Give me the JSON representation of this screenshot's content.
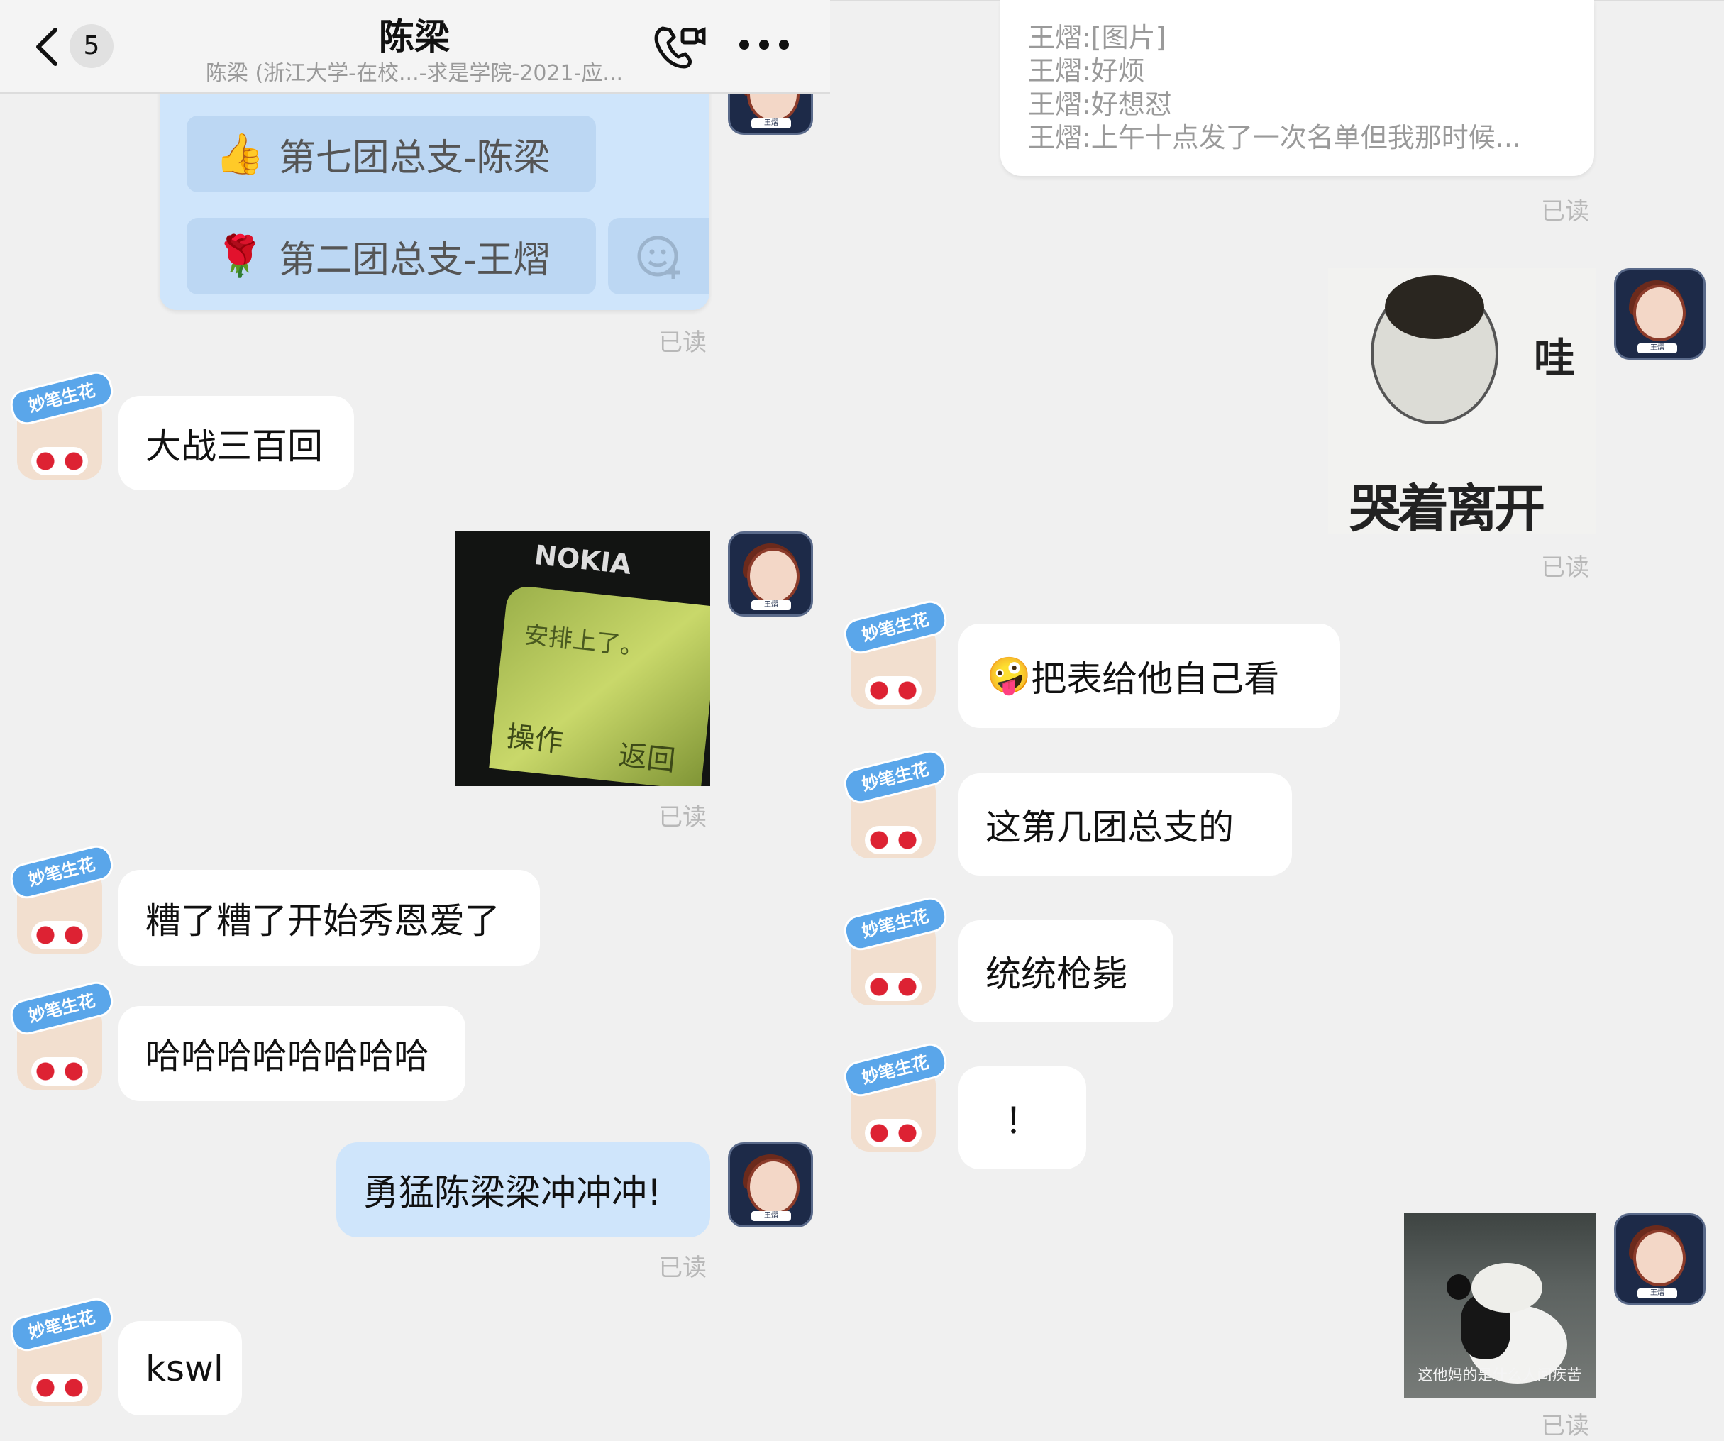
{
  "header": {
    "back_count": "5",
    "title": "陈梁",
    "subtitle": "陈梁 (浙江大学-在校...-求是学院-2021-应...",
    "call_icon": "phone-video-icon",
    "more_icon": "more-dots-icon"
  },
  "left": {
    "poll_options": [
      {
        "icon": "👍",
        "label": "第七团总支-陈梁"
      },
      {
        "icon": "🌹",
        "label": "第二团总支-王熠"
      }
    ],
    "add_reaction_icon": "emoji-add-icon",
    "read_label": "已读",
    "messages": [
      {
        "sender": "other",
        "text": "大战三百回"
      },
      {
        "sender": "self",
        "type": "image",
        "image": {
          "brand": "NOKIA",
          "screen_text": "安排上了。",
          "left_key": "操作",
          "right_key": "返回"
        }
      },
      {
        "sender": "other",
        "text": "糟了糟了开始秀恩爱了"
      },
      {
        "sender": "other",
        "text": "哈哈哈哈哈哈哈哈"
      },
      {
        "sender": "self",
        "text": "勇猛陈梁梁冲冲冲!"
      },
      {
        "sender": "other",
        "text": "kswl"
      }
    ]
  },
  "right": {
    "forwarded_lines": [
      "王熠:[图片]",
      "王熠:好烦",
      "王熠:好想怼",
      "王熠:上午十点发了一次名单但我那时候..."
    ],
    "read_label": "已读",
    "messages": [
      {
        "sender": "self",
        "type": "image",
        "image": {
          "top_text": "哇",
          "caption": "哭着离开"
        }
      },
      {
        "sender": "other",
        "emoji": "🤪",
        "text": "把表给他自己看"
      },
      {
        "sender": "other",
        "text": "这第几团总支的"
      },
      {
        "sender": "other",
        "text": "统统枪毙"
      },
      {
        "sender": "other",
        "text": "！"
      },
      {
        "sender": "self",
        "type": "image",
        "image": {
          "caption": "这他妈的是什么人间疾苦"
        }
      }
    ]
  },
  "avatars": {
    "other_ribbon": "妙笔生花",
    "self_tag": "王熠"
  },
  "colors": {
    "background": "#f0f0f0",
    "self_bubble": "#cfe5fb",
    "other_bubble": "#ffffff",
    "read": "#b8b8b8"
  }
}
